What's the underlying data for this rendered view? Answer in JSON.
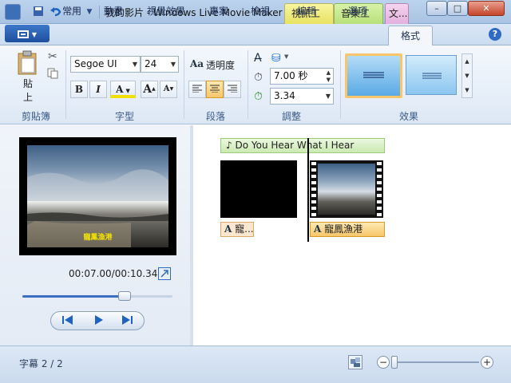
{
  "title_bar": {
    "title": "我的影片 - Windows Live Movie Maker",
    "context_tabs": [
      "視訊工具",
      "音樂工具",
      "文..."
    ],
    "window_buttons": {
      "minimize": "–",
      "maximize": "□",
      "close": "✕"
    }
  },
  "tabs": [
    "常用",
    "動畫",
    "視覺效果",
    "專案",
    "檢視",
    "編輯",
    "選項",
    "格式"
  ],
  "active_tab": "格式",
  "ribbon": {
    "clipboard": {
      "label": "剪貼簿",
      "paste": "貼上"
    },
    "font": {
      "label": "字型",
      "family": "Segoe UI",
      "size": "24",
      "bold": "B",
      "italic": "I",
      "color": "A",
      "grow": "A",
      "shrink": "A"
    },
    "paragraph": {
      "label": "段落",
      "transparency": "透明度"
    },
    "adjust": {
      "label": "調整",
      "duration": "7.00 秒",
      "start_time": "3.34"
    },
    "effects": {
      "label": "效果"
    }
  },
  "preview": {
    "caption": "寵鳳漁港",
    "time": "00:07.00/00:10.34",
    "progress": 0.68
  },
  "storyboard": {
    "music_title": "Do You Hear What I Hear",
    "caption1": "A 寵...",
    "caption2": "A 寵鳳漁港",
    "caption1_text": "寵...",
    "caption2_text": "寵鳳漁港"
  },
  "status": {
    "text": "字幕 2 / 2",
    "zoom_minus": "−",
    "zoom_plus": "+"
  },
  "colors": {
    "accent": "#1e4f9e",
    "caption_yellow": "#f2e100",
    "selection": "#f7c66a"
  }
}
